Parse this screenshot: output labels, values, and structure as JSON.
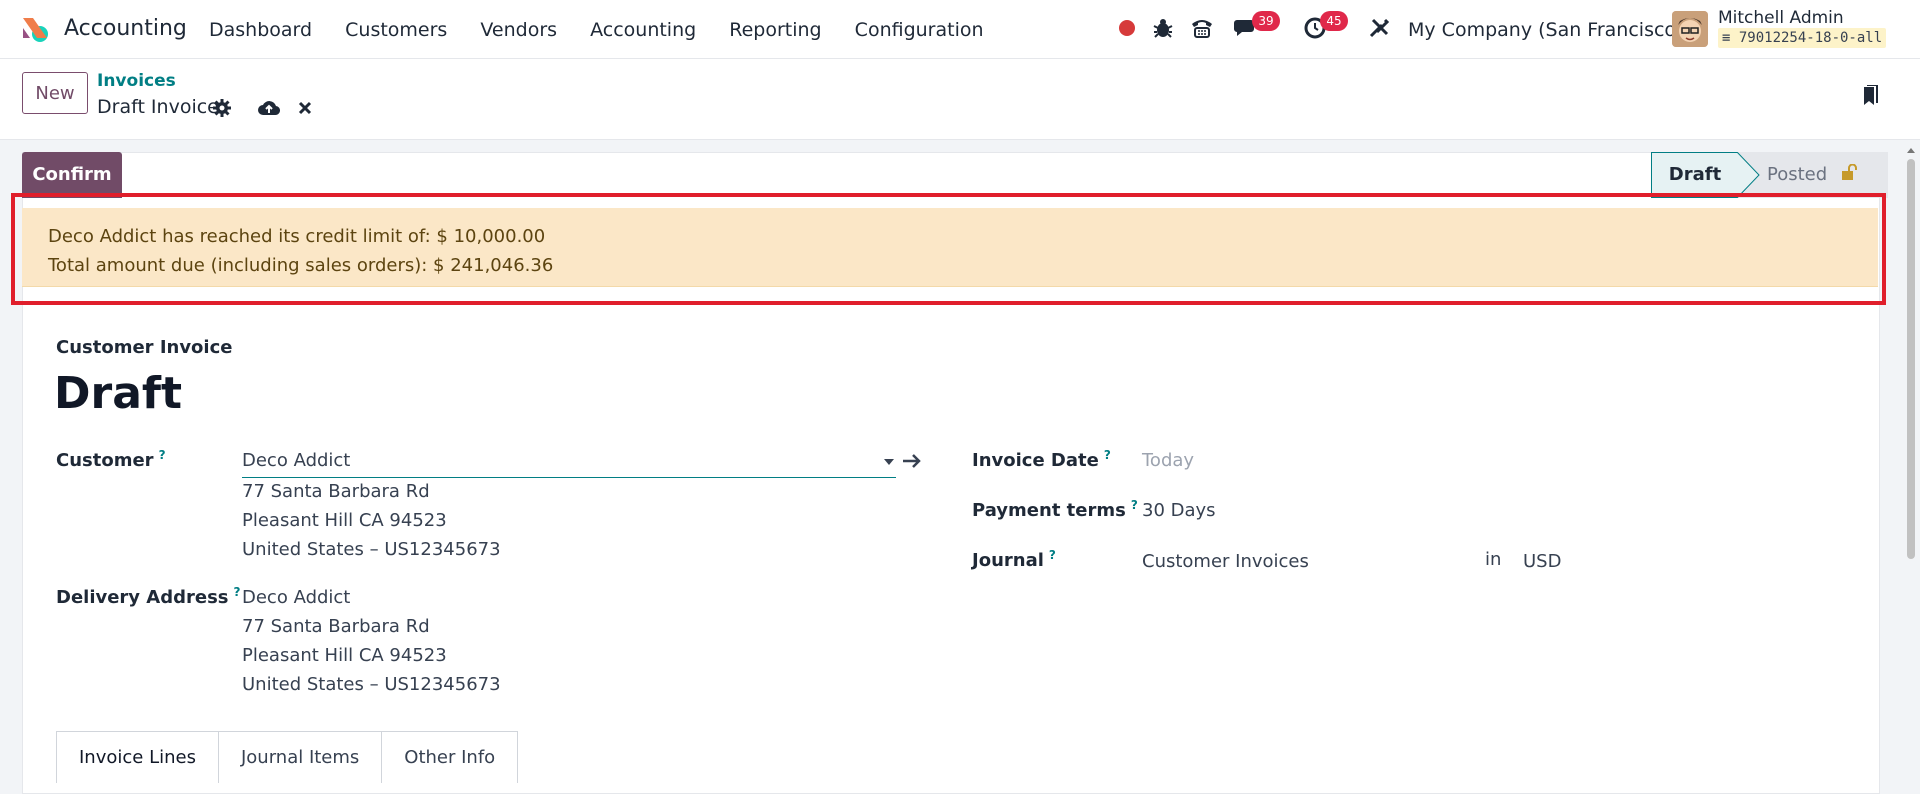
{
  "navbar": {
    "app_name": "Accounting",
    "menu": [
      "Dashboard",
      "Customers",
      "Vendors",
      "Accounting",
      "Reporting",
      "Configuration"
    ],
    "messages_count": "39",
    "activities_count": "45",
    "company": "My Company (San Francisco)",
    "user_name": "Mitchell Admin",
    "database": "79012254-18-0-all"
  },
  "control": {
    "new_label": "New",
    "breadcrumb_parent": "Invoices",
    "breadcrumb_current": "Draft Invoice"
  },
  "actions": {
    "confirm_label": "Confirm"
  },
  "status": {
    "stages": [
      "Draft",
      "Posted"
    ],
    "current": "Draft"
  },
  "alert": {
    "line1": "Deco Addict has reached its credit limit of: $ 10,000.00",
    "line2": "Total amount due (including sales orders): $ 241,046.36"
  },
  "form": {
    "doc_type": "Customer Invoice",
    "title": "Draft",
    "customer_label": "Customer",
    "customer_value": "Deco Addict",
    "customer_address": [
      "77 Santa Barbara Rd",
      "Pleasant Hill CA 94523",
      "United States – US12345673"
    ],
    "delivery_label": "Delivery Address",
    "delivery_address": [
      "Deco Addict",
      "77 Santa Barbara Rd",
      "Pleasant Hill CA 94523",
      "United States – US12345673"
    ],
    "invoice_date_label": "Invoice Date",
    "invoice_date_placeholder": "Today",
    "payment_terms_label": "Payment terms",
    "payment_terms_value": "30 Days",
    "journal_label": "Journal",
    "journal_value": "Customer Invoices",
    "journal_in": "in",
    "currency": "USD",
    "help_mark": "?"
  },
  "tabs": [
    "Invoice Lines",
    "Journal Items",
    "Other Info"
  ],
  "colors": {
    "primary": "#714b67",
    "teal": "#017e84",
    "alert_bg": "#fbe7c7",
    "highlight": "#e01e2b",
    "badge": "#e0284a"
  }
}
